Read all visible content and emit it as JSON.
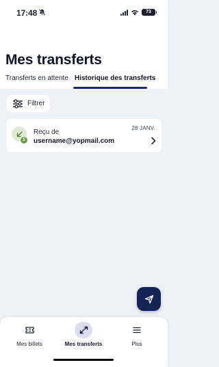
{
  "status_bar": {
    "time": "17:48",
    "battery": "73",
    "icons": [
      "bell-slash-icon",
      "signal-icon",
      "wifi-icon",
      "battery-icon"
    ]
  },
  "header": {
    "title": "Mes transferts"
  },
  "tabs": [
    {
      "label": "Transferts en attente",
      "active": false
    },
    {
      "label": "Historique des transferts",
      "active": true
    }
  ],
  "filter": {
    "label": "Filtrer",
    "icon": "sliders-icon"
  },
  "transfers": [
    {
      "label": "Reçu de",
      "email": "username@yopmail.com",
      "date": "28 JANV.",
      "count": "1",
      "icon": "arrow-down-left-icon"
    }
  ],
  "fab": {
    "icon": "send-icon"
  },
  "bottom_nav": [
    {
      "label": "Mes billets",
      "icon": "ticket-icon",
      "active": false
    },
    {
      "label": "Mes transferts",
      "icon": "transfer-arrows-icon",
      "active": true
    },
    {
      "label": "Plus",
      "icon": "menu-icon",
      "active": false
    }
  ],
  "colors": {
    "accent": "#1a2a6c",
    "fab": "#142456",
    "received_badge": "#66a047",
    "active_nav_bg": "#dcdcf2",
    "background": "#eef1f5"
  }
}
